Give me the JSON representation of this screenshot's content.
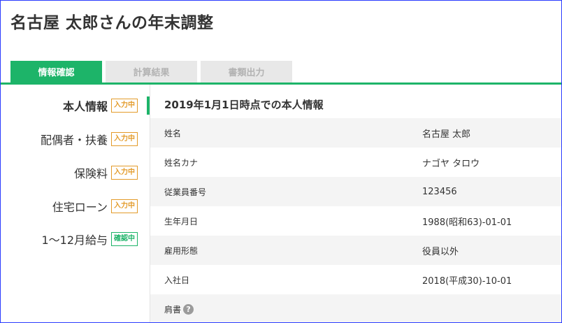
{
  "page": {
    "title": "名古屋 太郎さんの年末調整"
  },
  "tabs": [
    {
      "label": "情報確認",
      "active": true
    },
    {
      "label": "計算結果",
      "active": false
    },
    {
      "label": "書類出力",
      "active": false
    }
  ],
  "sidebar": {
    "items": [
      {
        "label": "本人情報",
        "badge": "入力中",
        "badge_type": "input",
        "current": true
      },
      {
        "label": "配偶者・扶養",
        "badge": "入力中",
        "badge_type": "input",
        "current": false
      },
      {
        "label": "保険料",
        "badge": "入力中",
        "badge_type": "input",
        "current": false
      },
      {
        "label": "住宅ローン",
        "badge": "入力中",
        "badge_type": "input",
        "current": false
      },
      {
        "label": "1〜12月給与",
        "badge": "確認中",
        "badge_type": "confirm",
        "current": false
      }
    ]
  },
  "section": {
    "title": "2019年1月1日時点での本人情報",
    "rows": [
      {
        "label": "姓名",
        "value": "名古屋 太郎"
      },
      {
        "label": "姓名カナ",
        "value": "ナゴヤ タロウ"
      },
      {
        "label": "従業員番号",
        "value": "123456"
      },
      {
        "label": "生年月日",
        "value": "1988(昭和63)-01-01"
      },
      {
        "label": "雇用形態",
        "value": "役員以外"
      },
      {
        "label": "入社日",
        "value": "2018(平成30)-10-01"
      },
      {
        "label": "肩書",
        "value": "",
        "help_icon": "?"
      }
    ]
  },
  "colors": {
    "accent": "#1db469",
    "badge_input": "#e39b2a",
    "badge_confirm": "#1db469",
    "tab_inactive_bg": "#e8e8e8",
    "row_shade": "#f4f4f4"
  },
  "icons": {
    "help": "question-mark-circle-icon"
  }
}
